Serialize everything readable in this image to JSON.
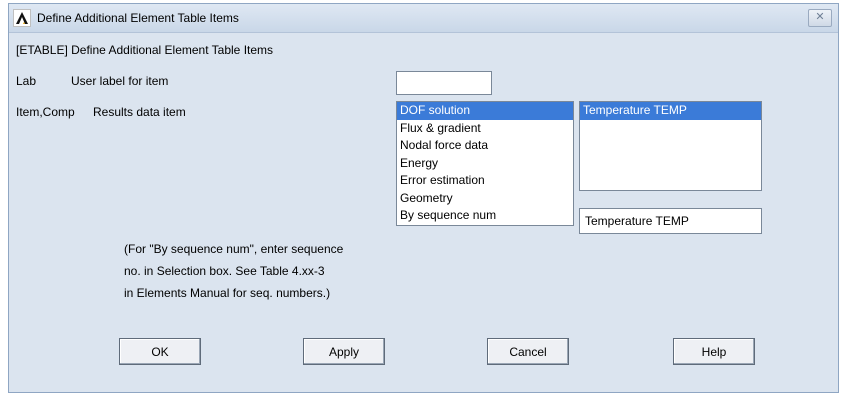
{
  "window": {
    "title": "Define Additional Element Table Items",
    "close_symbol": "✕"
  },
  "header": "[ETABLE]  Define Additional Element Table Items",
  "lab": {
    "name": "Lab",
    "desc": "User label for item",
    "value": ""
  },
  "item_comp": {
    "name": "Item,Comp",
    "desc": "Results data item"
  },
  "item_list": {
    "items": [
      "DOF solution",
      "Flux & gradient",
      "Nodal force data",
      "Energy",
      "Error estimation",
      "Geometry",
      "By sequence num"
    ],
    "selected_index": 0
  },
  "comp_list": {
    "items": [
      "Temperature TEMP"
    ],
    "selected_index": 0
  },
  "selection_field": {
    "value": "Temperature TEMP"
  },
  "note": {
    "line1": "(For \"By sequence num\", enter sequence",
    "line2": "no. in Selection box.  See Table 4.xx-3",
    "line3": "in Elements Manual for seq. numbers.)"
  },
  "buttons": {
    "ok": "OK",
    "apply": "Apply",
    "cancel": "Cancel",
    "help": "Help"
  },
  "colors": {
    "selection": "#3b7bd8",
    "dialog_bg": "#dbe4ef"
  },
  "icons": {
    "app": "ansys-logo-icon",
    "close": "close-icon"
  }
}
